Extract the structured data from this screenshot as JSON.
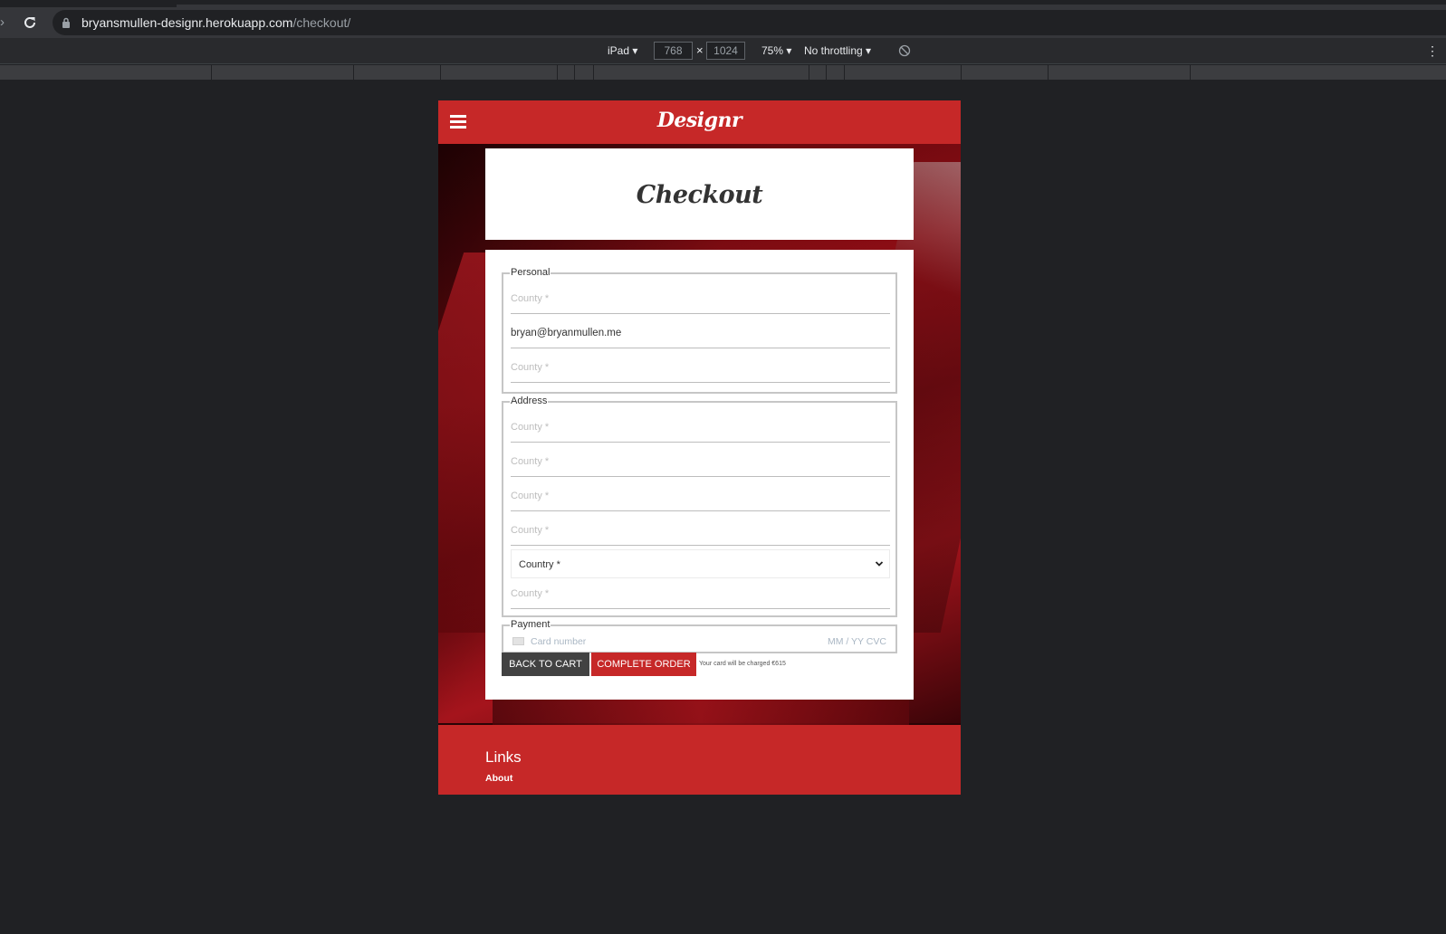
{
  "browser": {
    "url_host": "bryansmullen-designr.herokuapp.com",
    "url_path": "/checkout/"
  },
  "devtools": {
    "device": "iPad ▾",
    "width": "768",
    "times": "×",
    "height": "1024",
    "zoom": "75% ▾",
    "throttling": "No throttling ▾"
  },
  "site": {
    "brand": "Designr",
    "page_title": "Checkout",
    "personal": {
      "legend": "Personal",
      "fields": [
        {
          "value": "County *",
          "filled": false
        },
        {
          "value": "bryan@bryanmullen.me",
          "filled": true
        },
        {
          "value": "County *",
          "filled": false
        }
      ]
    },
    "address": {
      "legend": "Address",
      "fields": [
        {
          "value": "County *"
        },
        {
          "value": "County *"
        },
        {
          "value": "County *"
        },
        {
          "value": "County *"
        }
      ],
      "country_select": "Country *",
      "last_field": "County *"
    },
    "payment": {
      "legend": "Payment",
      "card_placeholder": "Card number",
      "exp_cvc_placeholder": "MM / YY  CVC"
    },
    "buttons": {
      "back": "BACK TO CART",
      "complete": "COMPLETE ORDER"
    },
    "charge_note": "Your card will be charged €615",
    "footer": {
      "title": "Links",
      "link": "About"
    }
  },
  "colors": {
    "brand_red": "#c62828",
    "dark_button": "#424242",
    "browser_bg": "#202124"
  }
}
